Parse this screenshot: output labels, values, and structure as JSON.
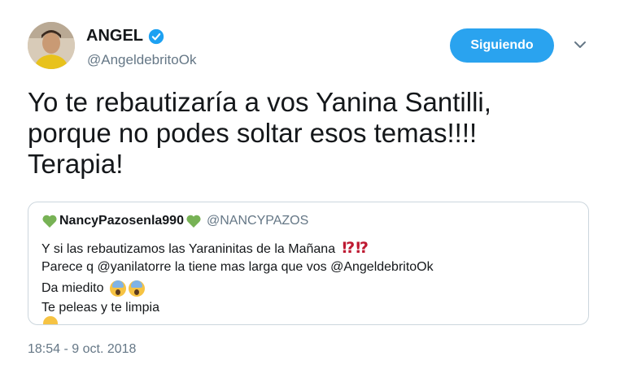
{
  "author": {
    "name": "ANGEL",
    "handle": "@AngeldebritoOk",
    "verified": true,
    "avatar_icon": "profile-avatar"
  },
  "follow_button": {
    "label": "Siguiendo",
    "color": "#2aa3ef"
  },
  "tweet": {
    "text": "Yo te rebautizaría a vos Yanina Santilli,\nporque no podes soltar esos temas!!!!\nTerapia!",
    "timestamp": "18:54 - 9 oct. 2018"
  },
  "quoted_tweet": {
    "name": "NancyPazosenla990",
    "handle": "@NANCYPAZOS",
    "heart_color": "#77b255",
    "lines": [
      "Y si las rebautizamos las Yaraninitas de la Mañana",
      "Parece q @yanilatorre la tiene mas larga que vos @AngeldebritoOk",
      "Da miedito",
      "Te peleas y te limpia"
    ],
    "line1_emoji": "⁉⁉"
  }
}
